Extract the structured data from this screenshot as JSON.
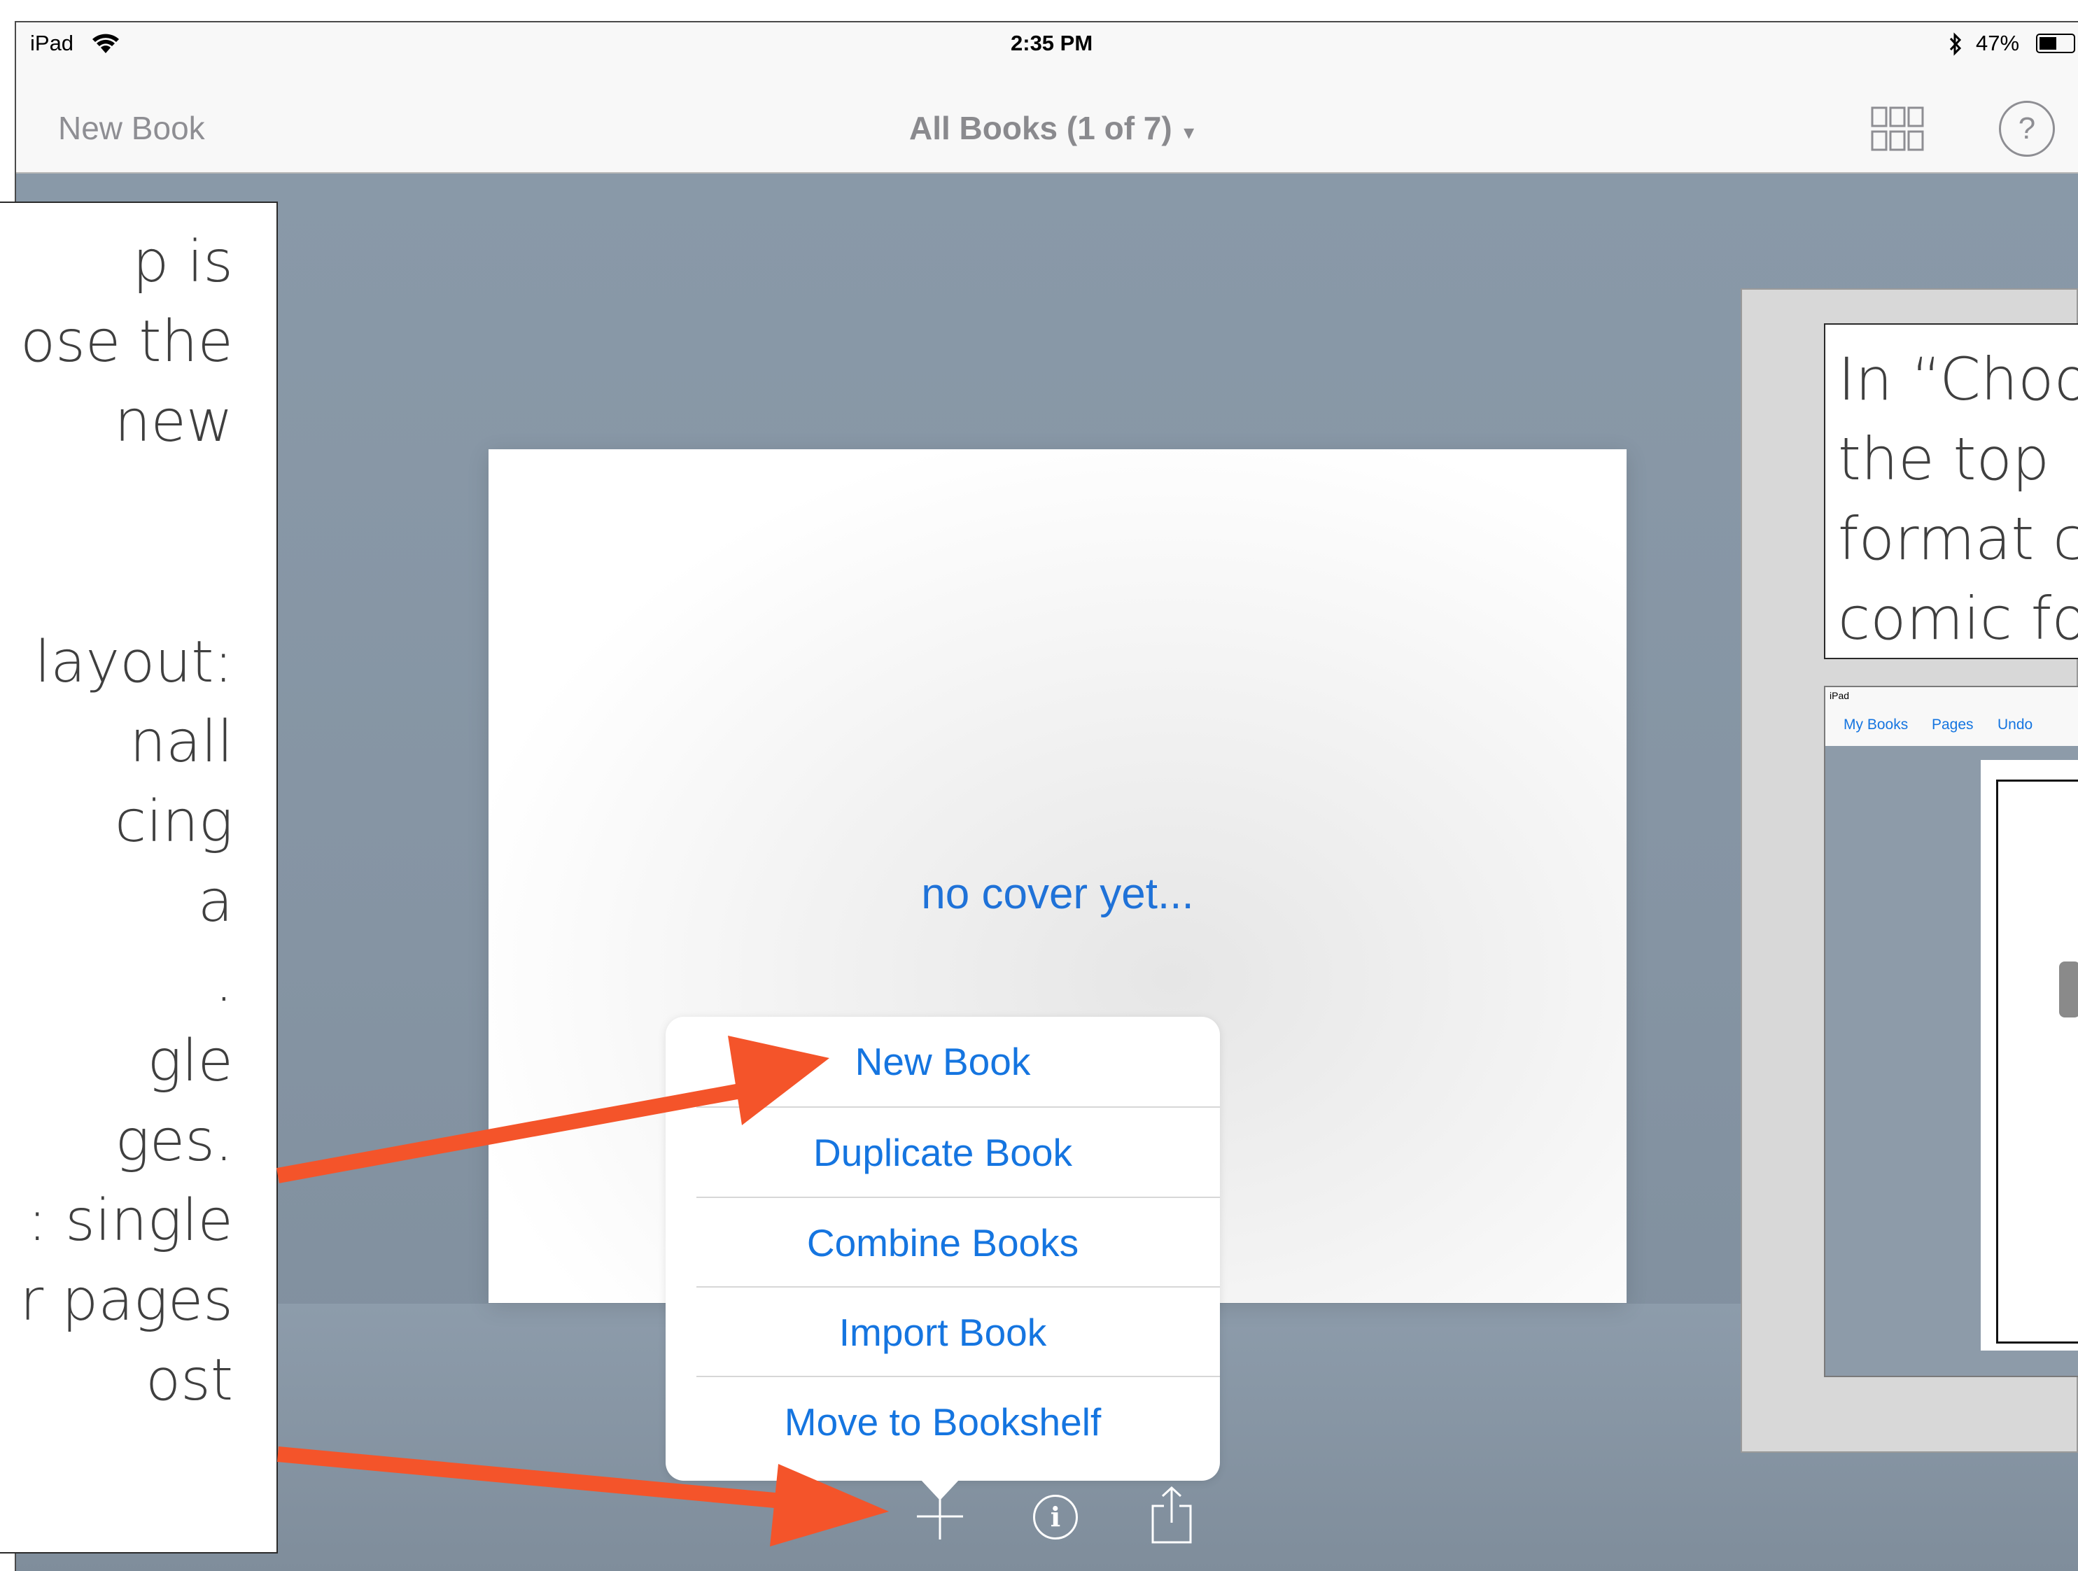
{
  "status_bar": {
    "device": "iPad",
    "time": "2:35 PM",
    "battery": "47%"
  },
  "nav_bar": {
    "new_book": "New Book",
    "title": "All Books (1 of 7)",
    "title_caret": "▾",
    "help": "?"
  },
  "cover": {
    "placeholder": "no cover yet..."
  },
  "menu": {
    "items": [
      "New Book",
      "Duplicate Book",
      "Combine Books",
      "Import Book",
      "Move to Bookshelf"
    ]
  },
  "toolbar": {
    "add_glyph": "+",
    "info_glyph": "i"
  },
  "left_note": {
    "lines": [
      "p is",
      "ose the",
      "new",
      "layout:",
      "nall",
      "cing",
      "a",
      ".",
      "gle",
      "ges.",
      ": single",
      "r pages",
      "ost"
    ]
  },
  "right_note": {
    "lines": [
      "In “Choo",
      "the top",
      "format c",
      "comic fo"
    ]
  },
  "mini_screenshot": {
    "device": "iPad",
    "nav": [
      "My Books",
      "Pages",
      "Undo"
    ]
  },
  "colors": {
    "accent_blue": "#1575e0",
    "arrow_orange": "#f4542a",
    "background_slate": "#8a9aa9"
  }
}
